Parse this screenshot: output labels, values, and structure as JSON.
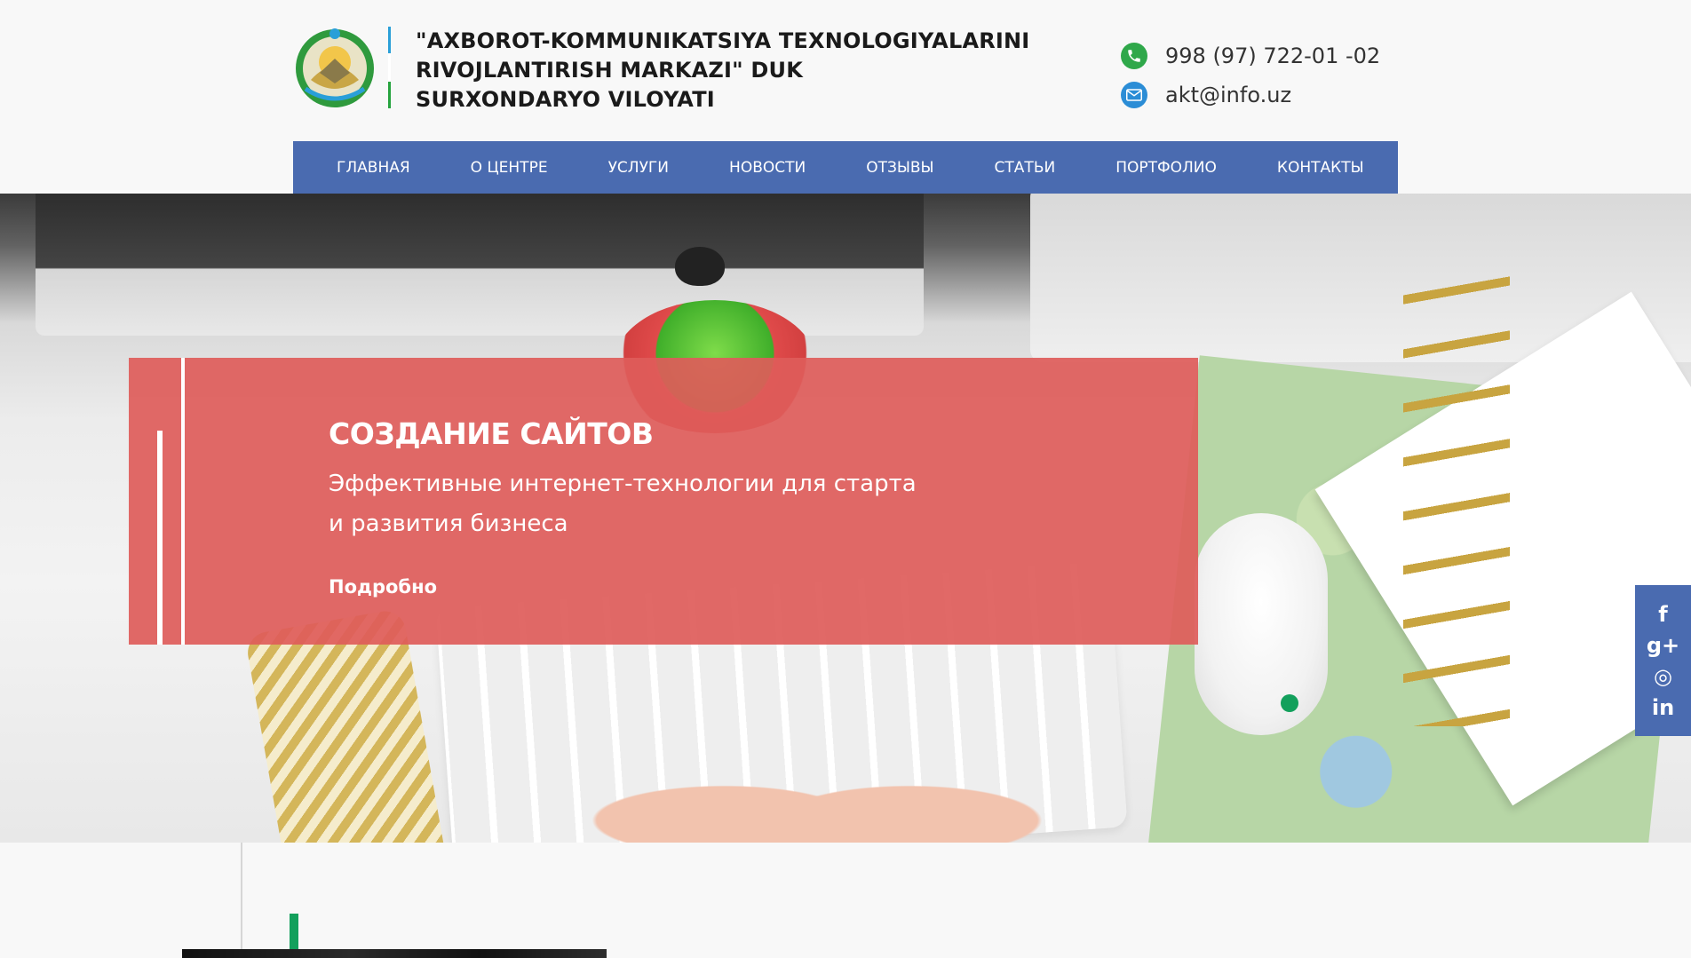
{
  "header": {
    "org_line1": "\"AXBOROT-KOMMUNIKATSIYA TEXNOLOGIYALARINI",
    "org_line2": "RIVOJLANTIRISH MARKAZI\" DUK",
    "org_line3": "SURXONDARYO VILOYATI",
    "phone": "998 (97) 722-01 -02",
    "email": "akt@info.uz",
    "phone_icon": "phone-icon",
    "email_icon": "envelope-icon"
  },
  "nav": {
    "items": [
      {
        "label": "ГЛАВНАЯ"
      },
      {
        "label": "О ЦЕНТРЕ"
      },
      {
        "label": "УСЛУГИ"
      },
      {
        "label": "НОВОСТИ"
      },
      {
        "label": "ОТЗЫВЫ"
      },
      {
        "label": "СТАТЬИ"
      },
      {
        "label": "ПОРТФОЛИО"
      },
      {
        "label": "КОНТАКТЫ"
      }
    ]
  },
  "hero": {
    "title": "СОЗДАНИЕ САЙТОВ",
    "subtitle_line1": "Эффективные интернет-технологии для старта",
    "subtitle_line2": "и развития бизнеса",
    "more_label": "Подробно"
  },
  "social": {
    "facebook": "f",
    "googleplus": "g+",
    "instagram": "◎",
    "linkedin": "in"
  },
  "colors": {
    "nav_bg": "#4a6bb0",
    "hero_overlay": "#de5c5a",
    "accent_green": "#13a05c"
  }
}
